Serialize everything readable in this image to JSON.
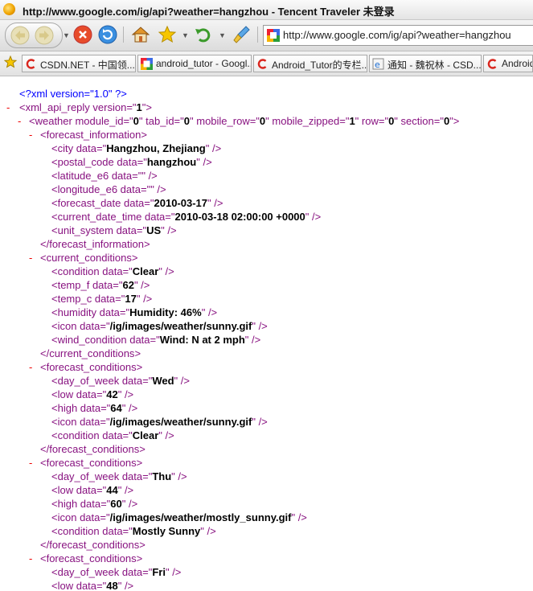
{
  "window": {
    "title": "http://www.google.com/ig/api?weather=hangzhou - Tencent Traveler  未登录"
  },
  "toolbar": {
    "address": "http://www.google.com/ig/api?weather=hangzhou",
    "icons": [
      "back-icon",
      "forward-icon",
      "stop-icon",
      "refresh-icon",
      "home-icon",
      "favorites-star-icon",
      "undo-icon",
      "clean-icon"
    ]
  },
  "bookmarks": [
    {
      "label": "CSDN.NET - 中国领...",
      "icon": "csdn-icon"
    },
    {
      "label": "android_tutor - Googl...",
      "icon": "google-icon"
    },
    {
      "label": "Android_Tutor的专栏...",
      "icon": "csdn-icon"
    },
    {
      "label": "通知 - 魏祝林 - CSD...",
      "icon": "ie-page-icon"
    },
    {
      "label": "Android",
      "icon": "csdn-icon"
    }
  ],
  "xml": {
    "pi": "<?xml version=\"1.0\" ?>",
    "lines": [
      {
        "tag": "<xml_api_reply",
        "attrs": [
          [
            "version",
            "1"
          ]
        ],
        "close": ">"
      },
      {
        "tag": "<weather",
        "attrs": [
          [
            "module_id",
            "0"
          ],
          [
            "tab_id",
            "0"
          ],
          [
            "mobile_row",
            "0"
          ],
          [
            "mobile_zipped",
            "1"
          ],
          [
            "row",
            "0"
          ],
          [
            "section",
            "0"
          ]
        ],
        "close": ">"
      },
      {
        "tag": "<forecast_information",
        "attrs": [],
        "close": ">"
      },
      {
        "tag": "<city",
        "attrs": [
          [
            "data",
            "Hangzhou, Zhejiang"
          ]
        ],
        "close": " />"
      },
      {
        "tag": "<postal_code",
        "attrs": [
          [
            "data",
            "hangzhou"
          ]
        ],
        "close": " />"
      },
      {
        "tag": "<latitude_e6",
        "attrs": [
          [
            "data",
            ""
          ]
        ],
        "close": " />"
      },
      {
        "tag": "<longitude_e6",
        "attrs": [
          [
            "data",
            ""
          ]
        ],
        "close": " />"
      },
      {
        "tag": "<forecast_date",
        "attrs": [
          [
            "data",
            "2010-03-17"
          ]
        ],
        "close": " />"
      },
      {
        "tag": "<current_date_time",
        "attrs": [
          [
            "data",
            "2010-03-18 02:00:00 +0000"
          ]
        ],
        "close": " />"
      },
      {
        "tag": "<unit_system",
        "attrs": [
          [
            "data",
            "US"
          ]
        ],
        "close": " />"
      },
      {
        "tag": "</forecast_information",
        "attrs": [],
        "close": ">"
      },
      {
        "tag": "<current_conditions",
        "attrs": [],
        "close": ">"
      },
      {
        "tag": "<condition",
        "attrs": [
          [
            "data",
            "Clear"
          ]
        ],
        "close": " />"
      },
      {
        "tag": "<temp_f",
        "attrs": [
          [
            "data",
            "62"
          ]
        ],
        "close": " />"
      },
      {
        "tag": "<temp_c",
        "attrs": [
          [
            "data",
            "17"
          ]
        ],
        "close": " />"
      },
      {
        "tag": "<humidity",
        "attrs": [
          [
            "data",
            "Humidity: 46%"
          ]
        ],
        "close": " />"
      },
      {
        "tag": "<icon",
        "attrs": [
          [
            "data",
            "/ig/images/weather/sunny.gif"
          ]
        ],
        "close": " />"
      },
      {
        "tag": "<wind_condition",
        "attrs": [
          [
            "data",
            "Wind: N at 2 mph"
          ]
        ],
        "close": " />"
      },
      {
        "tag": "</current_conditions",
        "attrs": [],
        "close": ">"
      },
      {
        "tag": "<forecast_conditions",
        "attrs": [],
        "close": ">"
      },
      {
        "tag": "<day_of_week",
        "attrs": [
          [
            "data",
            "Wed"
          ]
        ],
        "close": " />"
      },
      {
        "tag": "<low",
        "attrs": [
          [
            "data",
            "42"
          ]
        ],
        "close": " />"
      },
      {
        "tag": "<high",
        "attrs": [
          [
            "data",
            "64"
          ]
        ],
        "close": " />"
      },
      {
        "tag": "<icon",
        "attrs": [
          [
            "data",
            "/ig/images/weather/sunny.gif"
          ]
        ],
        "close": " />"
      },
      {
        "tag": "<condition",
        "attrs": [
          [
            "data",
            "Clear"
          ]
        ],
        "close": " />"
      },
      {
        "tag": "</forecast_conditions",
        "attrs": [],
        "close": ">"
      },
      {
        "tag": "<forecast_conditions",
        "attrs": [],
        "close": ">"
      },
      {
        "tag": "<day_of_week",
        "attrs": [
          [
            "data",
            "Thu"
          ]
        ],
        "close": " />"
      },
      {
        "tag": "<low",
        "attrs": [
          [
            "data",
            "44"
          ]
        ],
        "close": " />"
      },
      {
        "tag": "<high",
        "attrs": [
          [
            "data",
            "60"
          ]
        ],
        "close": " />"
      },
      {
        "tag": "<icon",
        "attrs": [
          [
            "data",
            "/ig/images/weather/mostly_sunny.gif"
          ]
        ],
        "close": " />"
      },
      {
        "tag": "<condition",
        "attrs": [
          [
            "data",
            "Mostly Sunny"
          ]
        ],
        "close": " />"
      },
      {
        "tag": "</forecast_conditions",
        "attrs": [],
        "close": ">"
      },
      {
        "tag": "<forecast_conditions",
        "attrs": [],
        "close": ">"
      },
      {
        "tag": "<day_of_week",
        "attrs": [
          [
            "data",
            "Fri"
          ]
        ],
        "close": " />"
      },
      {
        "tag": "<low",
        "attrs": [
          [
            "data",
            "48"
          ]
        ],
        "close": " />"
      }
    ]
  },
  "colors": {
    "tag": "#881280",
    "pi": "#0000ff",
    "collapse": "#ee0000",
    "value": "#000000"
  }
}
